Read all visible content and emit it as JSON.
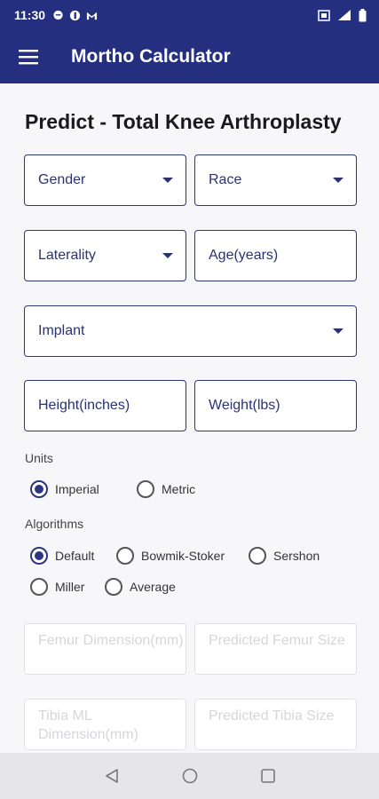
{
  "status_bar": {
    "time": "11:30"
  },
  "app_bar": {
    "title": "Mortho Calculator"
  },
  "page": {
    "title": "Predict - Total Knee Arthroplasty"
  },
  "form": {
    "gender": "Gender",
    "race": "Race",
    "laterality": "Laterality",
    "age": "Age(years)",
    "implant": "Implant",
    "height": "Height(inches)",
    "weight": "Weight(lbs)"
  },
  "units": {
    "label": "Units",
    "options": [
      "Imperial",
      "Metric"
    ],
    "selected": "Imperial"
  },
  "algorithms": {
    "label": "Algorithms",
    "options": [
      "Default",
      "Bowmik-Stoker",
      "Sershon",
      "Miller",
      "Average"
    ],
    "selected": "Default"
  },
  "outputs": {
    "femur_dimension": "Femur Dimension(mm)",
    "predicted_femur_size": "Predicted Femur Size",
    "tibia_ml_dimension": "Tibia ML Dimension(mm)",
    "predicted_tibia_size": "Predicted Tibia Size"
  },
  "colors": {
    "primary": "#24307f",
    "field_border": "#2c3680",
    "background": "#f7f7f9"
  },
  "icons": {
    "menu": "hamburger-menu-icon",
    "dropdown": "caret-down-icon",
    "nav_back": "back-triangle-icon",
    "nav_home": "home-circle-icon",
    "nav_recents": "recents-square-icon"
  }
}
